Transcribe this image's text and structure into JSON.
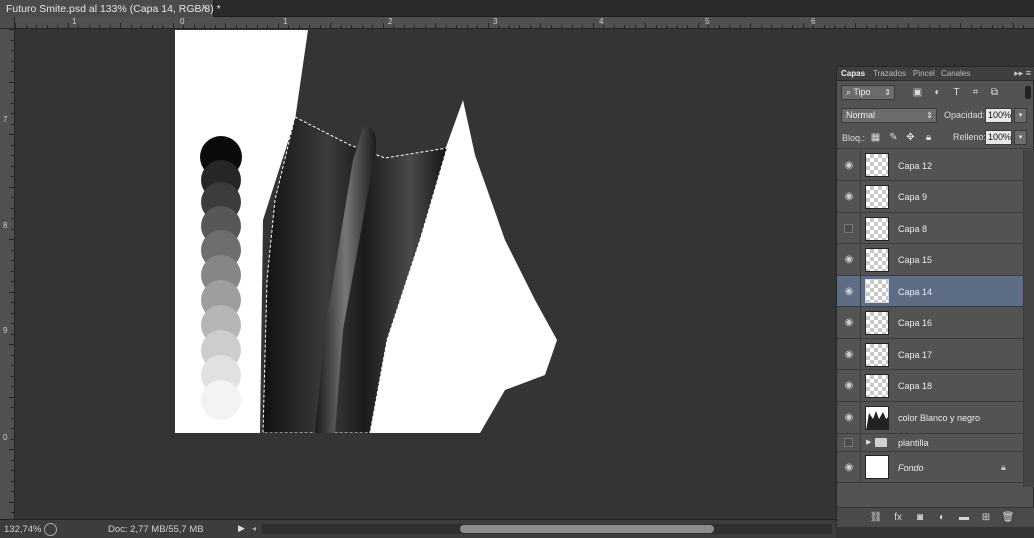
{
  "document": {
    "tab_title": "Futuro Smite.psd al 133% (Capa 14, RGB/8) *",
    "close_glyph": "×"
  },
  "rulers": {
    "top_labels": [
      "0",
      "1",
      "1",
      "2",
      "3",
      "4",
      "5",
      "6"
    ],
    "left_labels": [
      "7",
      "8",
      "9",
      "0"
    ]
  },
  "status": {
    "zoom": "132,74%",
    "doc_size": "Doc: 2,77 MB/55,7 MB"
  },
  "panel": {
    "tabs": [
      "Capas",
      "Trazados",
      "Pincel",
      "Canales"
    ],
    "filter_kind": "Tipo",
    "blend_mode": "Normal",
    "opacity_label": "Opacidad:",
    "opacity_value": "100%",
    "lock_label": "Bloq.:",
    "fill_label": "Relleno:",
    "fill_value": "100%",
    "layers": [
      {
        "name": "Capa 12",
        "visible": true,
        "selected": false
      },
      {
        "name": "Capa 9",
        "visible": true,
        "selected": false
      },
      {
        "name": "Capa 8",
        "visible": false,
        "selected": false
      },
      {
        "name": "Capa 15",
        "visible": true,
        "selected": false
      },
      {
        "name": "Capa 14",
        "visible": true,
        "selected": true
      },
      {
        "name": "Capa 16",
        "visible": true,
        "selected": false
      },
      {
        "name": "Capa 17",
        "visible": true,
        "selected": false
      },
      {
        "name": "Capa 18",
        "visible": true,
        "selected": false
      },
      {
        "name": "color Blanco y negro",
        "visible": true,
        "selected": false
      },
      {
        "name": "plantilla",
        "visible": false,
        "selected": false,
        "group": true
      },
      {
        "name": "Fondo",
        "visible": true,
        "selected": false,
        "locked": true
      }
    ]
  },
  "colors": {
    "selected_row": "#5c6d85",
    "canvas_bg": "#343434",
    "panel_bg": "#535353"
  }
}
